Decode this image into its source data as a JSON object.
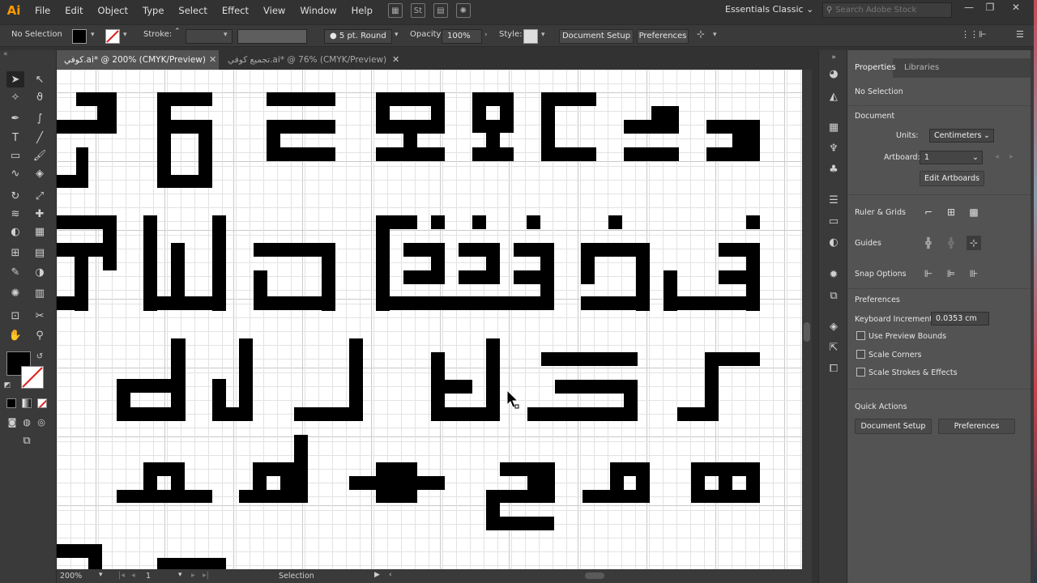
{
  "app": {
    "logo": "Ai"
  },
  "menu": [
    "File",
    "Edit",
    "Object",
    "Type",
    "Select",
    "Effect",
    "View",
    "Window",
    "Help"
  ],
  "menu_icons": {
    "stock": "St"
  },
  "workspace": "Essentials Classic",
  "search": {
    "placeholder": "Search Adobe Stock"
  },
  "control": {
    "selection": "No Selection",
    "stroke_label": "Stroke:",
    "brush": "5 pt. Round",
    "opacity_label": "Opacity:",
    "opacity_value": "100%",
    "style_label": "Style:",
    "document_setup": "Document Setup",
    "preferences": "Preferences"
  },
  "tabs": [
    {
      "label": "كوفي.ai* @ 200% (CMYK/Preview)",
      "active": true
    },
    {
      "label": "تجميع كوفي.ai* @ 76% (CMYK/Preview)",
      "active": false
    }
  ],
  "status": {
    "zoom": "200%",
    "artboard": "1",
    "tool": "Selection"
  },
  "panel": {
    "tab_properties": "Properties",
    "tab_libraries": "Libraries",
    "selection": "No Selection",
    "document_heading": "Document",
    "units_label": "Units:",
    "units_value": "Centimeters",
    "artboard_label": "Artboard:",
    "artboard_value": "1",
    "edit_artboards": "Edit Artboards",
    "rulers_grids": "Ruler & Grids",
    "guides": "Guides",
    "snap_options": "Snap Options",
    "preferences_heading": "Preferences",
    "keyboard_increment_label": "Keyboard Increment:",
    "keyboard_increment_value": "0.0353 cm",
    "use_preview_bounds": "Use Preview Bounds",
    "scale_corners": "Scale Corners",
    "scale_strokes": "Scale Strokes & Effects",
    "quick_actions": "Quick Actions",
    "qa_document_setup": "Document Setup",
    "qa_preferences": "Preferences"
  },
  "colors": {
    "accent": "#ff9a00",
    "ui_dark": "#323232",
    "panel": "#535353",
    "canvas": "#ffffff",
    "glyph": "#000000"
  }
}
